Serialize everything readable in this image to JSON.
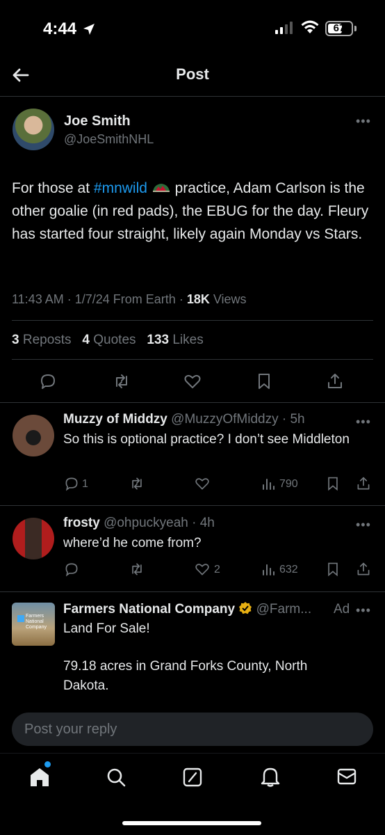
{
  "status_bar": {
    "time": "4:44",
    "battery": "67",
    "battery_level": 0.67
  },
  "header": {
    "title": "Post"
  },
  "post": {
    "author_name": "Joe Smith",
    "author_handle": "@JoeSmithNHL",
    "text_before": "For those at ",
    "hashtag": "#mnwild",
    "text_after": " practice, Adam Carlson is the other goalie (in red pads), the EBUG for the day. Fleury has started four straight, likely again Monday vs Stars.",
    "time": "11:43 AM",
    "date": "1/7/24",
    "source": "From Earth",
    "views_count": "18K",
    "views_label": "Views",
    "reposts_count": "3",
    "reposts_label": "Reposts",
    "quotes_count": "4",
    "quotes_label": "Quotes",
    "likes_count": "133",
    "likes_label": "Likes"
  },
  "replies": [
    {
      "name": "Muzzy of Middzy",
      "handle": "@MuzzyOfMiddzy",
      "time": "5h",
      "text": "So this is optional practice? I don’t see Middleton",
      "replies": "1",
      "reposts": "",
      "likes": "",
      "views": "790"
    },
    {
      "name": "frosty",
      "handle": "@ohpuckyeah",
      "time": "4h",
      "text": "where’d he come from?",
      "replies": "",
      "reposts": "",
      "likes": "2",
      "views": "632"
    }
  ],
  "ad": {
    "name": "Farmers National Company",
    "handle": "@Farm...",
    "ad_label": "Ad",
    "line1": "Land For Sale!",
    "line2": "79.18 acres in Grand Forks County, North Dakota.",
    "logo_text": "Farmers National Company"
  },
  "reply_box": {
    "placeholder": "Post your reply"
  },
  "nav": [
    "home-icon",
    "search-icon",
    "grok-icon",
    "notifications-icon",
    "messages-icon"
  ],
  "colors": {
    "accent": "#1d9bf0",
    "muted": "#71767b",
    "background": "#000000",
    "verified_gold": "#e8b012"
  }
}
